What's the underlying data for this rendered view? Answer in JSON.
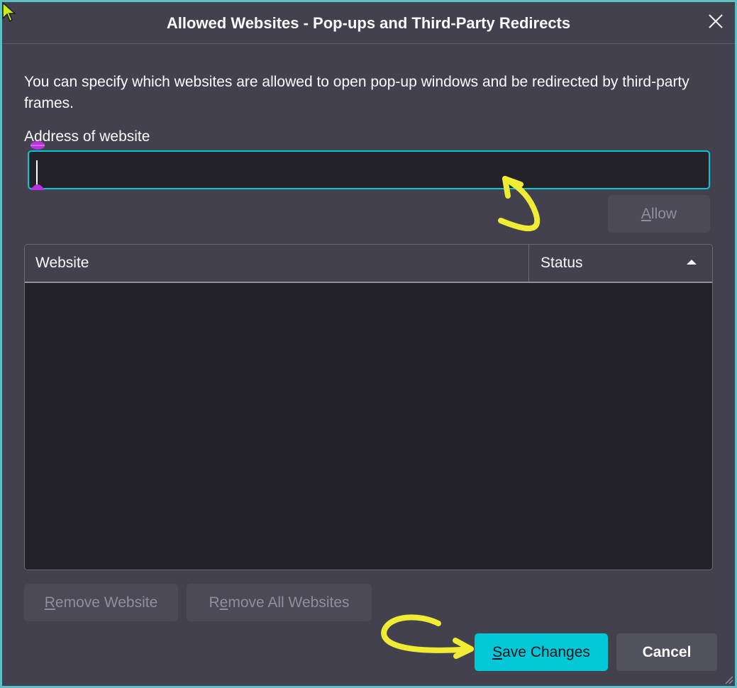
{
  "window": {
    "title": "Allowed Websites - Pop-ups and Third-Party Redirects"
  },
  "description": "You can specify which websites are allowed to open pop-up windows and be redirected by third-party frames.",
  "address": {
    "label": "Address of website",
    "value": "",
    "placeholder": ""
  },
  "buttons": {
    "allow_accesskey": "A",
    "allow_rest": "llow",
    "remove_accesskey": "R",
    "remove_rest": "emove Website",
    "remove_all_pre": "R",
    "remove_all_accesskey": "e",
    "remove_all_rest": "move All Websites",
    "save_accesskey": "S",
    "save_rest": "ave Changes",
    "cancel": "Cancel"
  },
  "table": {
    "columns": [
      "Website",
      "Status"
    ],
    "sort": "ascending",
    "rows": []
  },
  "colors": {
    "accent": "#00c8d7",
    "background": "#42414d",
    "field": "#23222b",
    "annotation": "#f0ec34",
    "handle": "#b933e1"
  }
}
